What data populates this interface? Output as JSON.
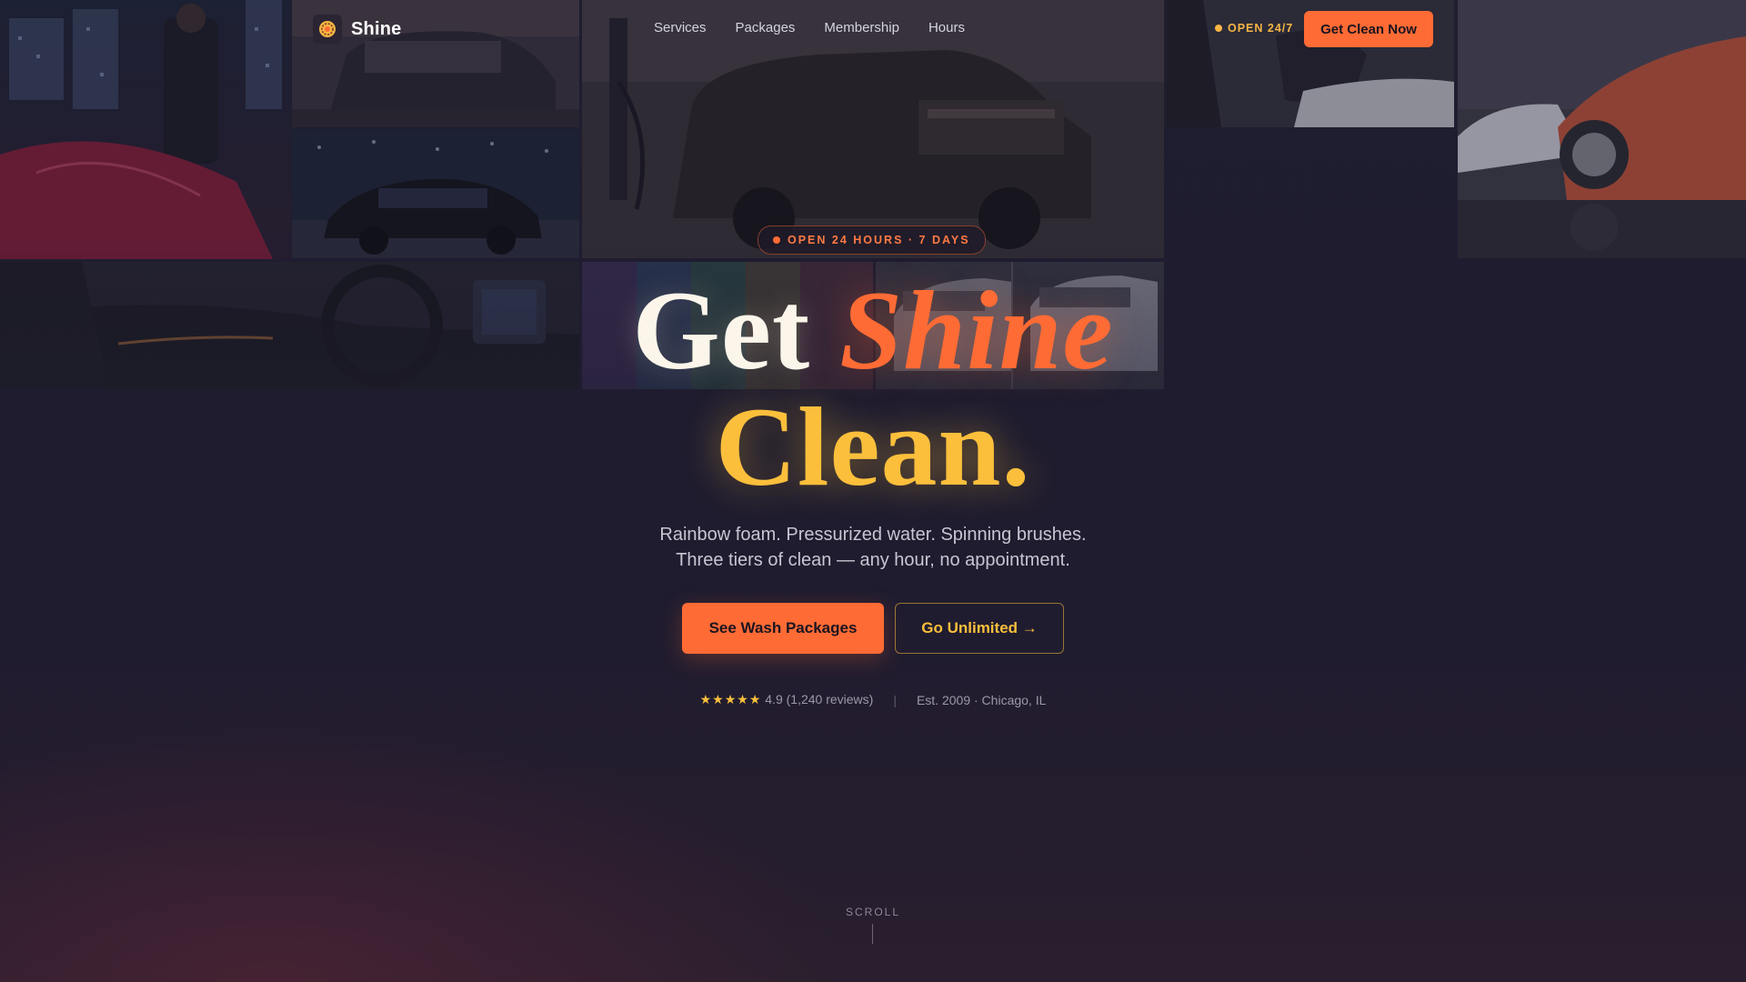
{
  "brand": {
    "name": "Shine",
    "logo_icon": "sun-emblem-icon"
  },
  "nav": {
    "links": [
      {
        "label": "Services"
      },
      {
        "label": "Packages"
      },
      {
        "label": "Membership"
      },
      {
        "label": "Hours"
      }
    ],
    "status": "OPEN 24/7",
    "cta_label": "Get Clean Now"
  },
  "hero": {
    "pill": "OPEN 24 HOURS · 7 DAYS",
    "headline": {
      "word1": "Get",
      "word2": "Shine",
      "word3": "Clean."
    },
    "subtext_line1": "Rainbow foam. Pressurized water. Spinning brushes.",
    "subtext_line2": "Three tiers of clean — any hour, no appointment.",
    "primary_cta": "See Wash Packages",
    "secondary_cta": "Go Unlimited →",
    "stars": "★★★★★",
    "rating": "4.9 (1,240 reviews)",
    "separator": "|",
    "established": "Est. 2009 · Chicago, IL"
  },
  "scroll_label": "SCROLL",
  "colors": {
    "accent_orange": "#ff6b35",
    "accent_gold": "#fbbf3c",
    "background": "#1f1d30",
    "headline_cream": "#fbf5ea"
  }
}
